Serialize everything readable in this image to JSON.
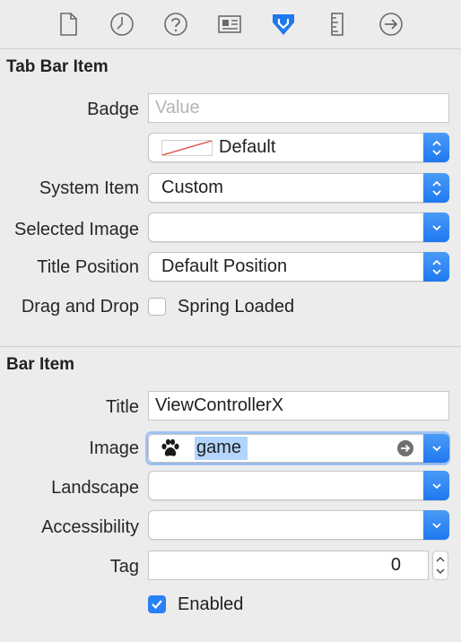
{
  "toolbar": {
    "icons": [
      "file-icon",
      "clock-icon",
      "help-icon",
      "identity-icon",
      "attributes-icon",
      "ruler-icon",
      "connections-icon"
    ],
    "selected": "attributes-icon",
    "accent": "#1f78f0"
  },
  "tab_bar_item": {
    "header": "Tab Bar Item",
    "badge_label": "Badge",
    "badge_placeholder": "Value",
    "badge_color_value": "Default",
    "system_item_label": "System Item",
    "system_item_value": "Custom",
    "selected_image_label": "Selected Image",
    "selected_image_value": "",
    "title_position_label": "Title Position",
    "title_position_value": "Default Position",
    "drag_drop_label": "Drag and Drop",
    "spring_loaded_label": "Spring Loaded",
    "spring_loaded_checked": false
  },
  "bar_item": {
    "header": "Bar Item",
    "title_label": "Title",
    "title_value": "ViewControllerX",
    "image_label": "Image",
    "image_value": "game",
    "landscape_label": "Landscape",
    "landscape_value": "",
    "accessibility_label": "Accessibility",
    "accessibility_value": "",
    "tag_label": "Tag",
    "tag_value": "0",
    "enabled_label": "Enabled",
    "enabled_checked": true
  }
}
